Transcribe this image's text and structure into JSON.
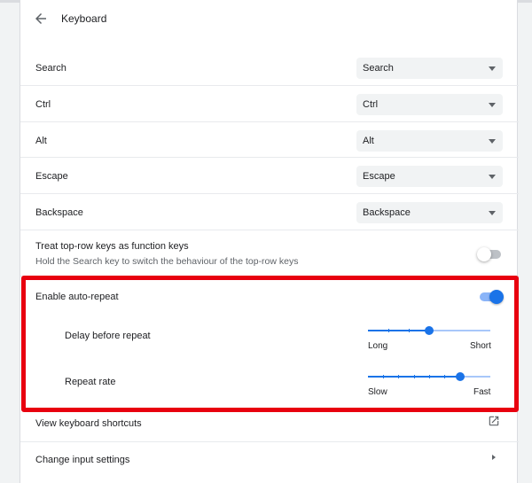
{
  "header": {
    "title": "Keyboard"
  },
  "remap_rows": [
    {
      "label": "Search",
      "value": "Search"
    },
    {
      "label": "Ctrl",
      "value": "Ctrl"
    },
    {
      "label": "Alt",
      "value": "Alt"
    },
    {
      "label": "Escape",
      "value": "Escape"
    },
    {
      "label": "Backspace",
      "value": "Backspace"
    }
  ],
  "function_keys": {
    "label": "Treat top-row keys as function keys",
    "description": "Hold the Search key to switch the behaviour of the top-row keys",
    "enabled": false
  },
  "auto_repeat": {
    "label": "Enable auto-repeat",
    "enabled": true,
    "delay": {
      "label": "Delay before repeat",
      "min_label": "Long",
      "max_label": "Short",
      "value": 0.5
    },
    "rate": {
      "label": "Repeat rate",
      "min_label": "Slow",
      "max_label": "Fast",
      "value": 0.75
    }
  },
  "shortcuts": {
    "label": "View keyboard shortcuts"
  },
  "input_settings": {
    "label": "Change input settings"
  },
  "colors": {
    "accent": "#1a73e8",
    "highlight": "#e8000f",
    "toggle_off": "#bdc1c6"
  }
}
